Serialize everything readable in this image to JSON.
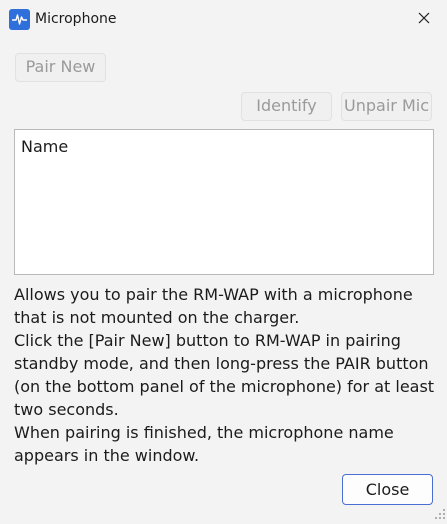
{
  "window": {
    "title": "Microphone",
    "icon": "microphone-app-icon",
    "accent_color": "#2f6fdb"
  },
  "buttons": {
    "pair_new": "Pair New",
    "identify": "Identify",
    "unpair_mic": "Unpair Mic",
    "close": "Close"
  },
  "list": {
    "header": "Name",
    "items": []
  },
  "description": {
    "lines": [
      "Allows you to pair the RM-WAP with a microphone",
      "that is not mounted on the charger.",
      "Click the [Pair New] button to RM-WAP in pairing",
      "standby mode, and then long-press the PAIR button",
      "(on the bottom panel of the microphone) for at least",
      "two seconds.",
      "When pairing is finished, the microphone name",
      "appears in the window."
    ]
  }
}
